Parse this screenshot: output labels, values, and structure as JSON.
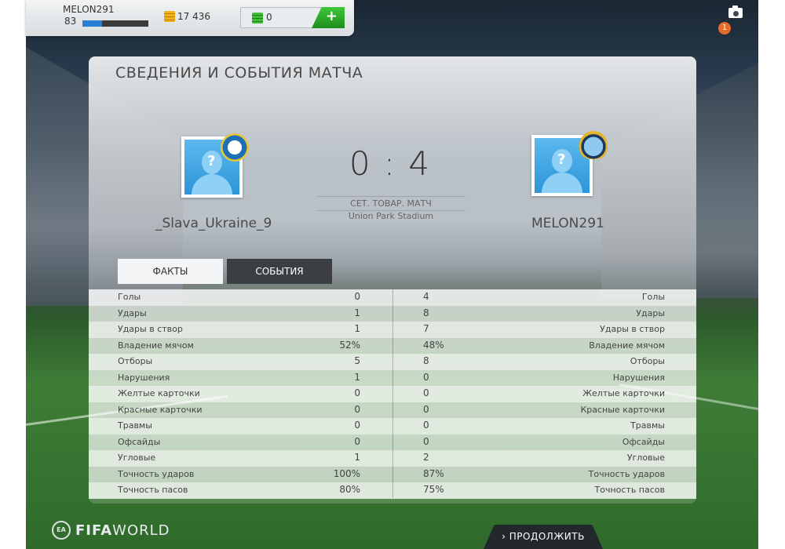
{
  "user": {
    "name": "MELON291",
    "level": "83",
    "xp_progress": 0.3,
    "coins": "17 436",
    "points": "0",
    "add_label": "+"
  },
  "notification_count": "1",
  "panel": {
    "title": "СВЕДЕНИЯ И СОБЫТИЯ МАТЧА"
  },
  "match": {
    "home_team": "_Slava_Ukraine_9",
    "away_team": "MELON291",
    "score": "0 : 4",
    "type": "СЕТ. ТОВАР. МАТЧ",
    "stadium": "Union Park Stadium"
  },
  "tabs": {
    "facts": "ФАКТЫ",
    "events": "СОБЫТИЯ"
  },
  "stats": [
    {
      "label": "Голы",
      "home": "0",
      "away": "4"
    },
    {
      "label": "Удары",
      "home": "1",
      "away": "8"
    },
    {
      "label": "Удары в створ",
      "home": "1",
      "away": "7"
    },
    {
      "label": "Владение мячом",
      "home": "52%",
      "away": "48%"
    },
    {
      "label": "Отборы",
      "home": "5",
      "away": "8"
    },
    {
      "label": "Нарушения",
      "home": "1",
      "away": "0"
    },
    {
      "label": "Желтые карточки",
      "home": "0",
      "away": "0"
    },
    {
      "label": "Красные карточки",
      "home": "0",
      "away": "0"
    },
    {
      "label": "Травмы",
      "home": "0",
      "away": "0"
    },
    {
      "label": "Офсайды",
      "home": "0",
      "away": "0"
    },
    {
      "label": "Угловые",
      "home": "1",
      "away": "2"
    },
    {
      "label": "Точность ударов",
      "home": "100%",
      "away": "87%"
    },
    {
      "label": "Точность пасов",
      "home": "80%",
      "away": "75%"
    }
  ],
  "footer": {
    "brand_light": "FIFA",
    "brand_rest": "WORLD",
    "continue_label": "› ПРОДОЛЖИТЬ"
  },
  "colors": {
    "accent_green": "#2aa826",
    "tab_active": "#3b3f43",
    "notification": "#e86a2b",
    "avatar_blue": "#2d95d8"
  }
}
